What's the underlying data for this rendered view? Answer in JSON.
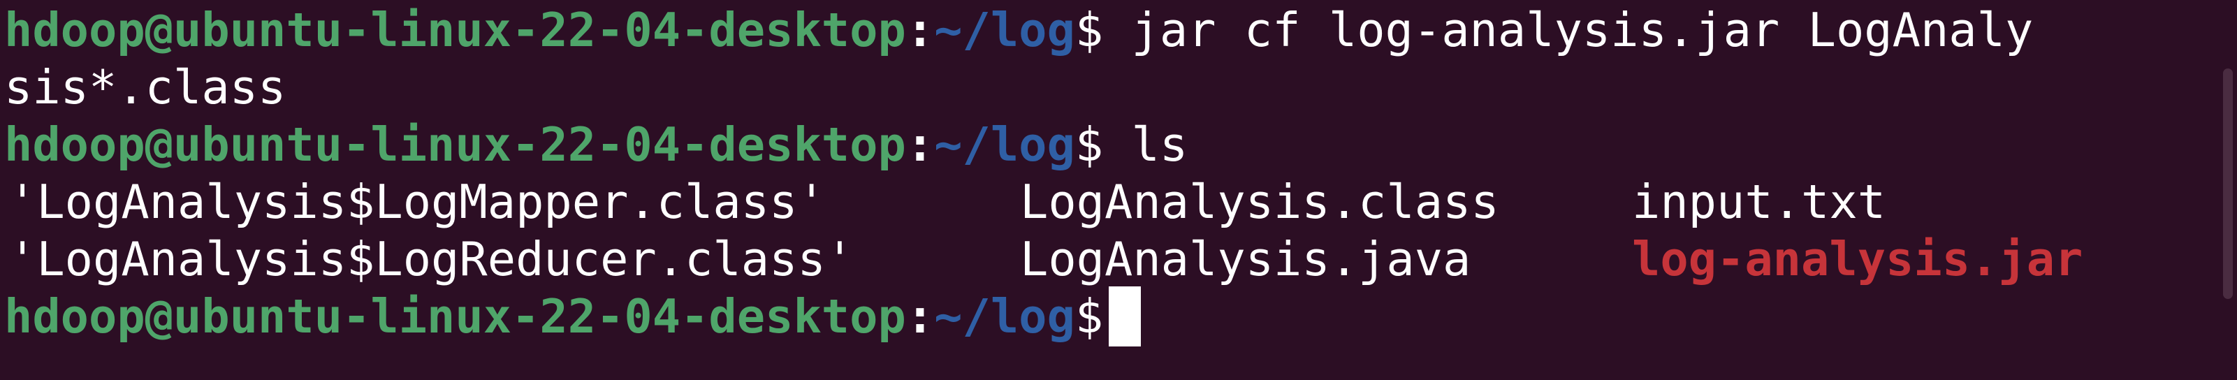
{
  "prompt": {
    "user_host": "hdoop@ubuntu-linux-22-04-desktop",
    "colon": ":",
    "path": "~/log",
    "dollar": "$"
  },
  "lines": {
    "cmd1_part1": " jar cf log-analysis.jar LogAnaly",
    "cmd1_part2": "sis*.class",
    "cmd2": " ls"
  },
  "ls_output": {
    "row1": {
      "col1": "'LogAnalysis$LogMapper.class'",
      "col2": "LogAnalysis.class",
      "col3": "input.txt"
    },
    "row2": {
      "col1": "'LogAnalysis$LogReducer.class'",
      "col2": "LogAnalysis.java",
      "col3": "log-analysis.jar"
    }
  },
  "colors": {
    "background": "#2c0e24",
    "prompt_user": "#4fa56a",
    "prompt_path": "#2f5fa5",
    "jar_file": "#c7343a",
    "text": "#ffffff"
  }
}
